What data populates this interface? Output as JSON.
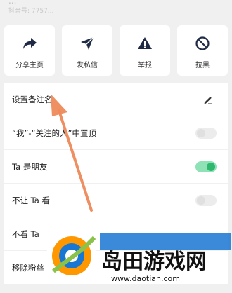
{
  "header": {
    "name_fragment": "...",
    "id_fragment": "抖音号: 7757..."
  },
  "actions": [
    {
      "label": "分享主页",
      "icon": "share-icon"
    },
    {
      "label": "发私信",
      "icon": "send-icon"
    },
    {
      "label": "举报",
      "icon": "warning-icon"
    },
    {
      "label": "拉黑",
      "icon": "block-icon"
    }
  ],
  "settings": [
    {
      "label": "设置备注名",
      "control": "pen-icon"
    },
    {
      "label": "“我”-“关注的人”中置顶",
      "control": "toggle",
      "on": false
    },
    {
      "label": "Ta 是朋友",
      "control": "toggle",
      "on": true
    },
    {
      "label": "不让 Ta 看",
      "control": "toggle",
      "on": false
    },
    {
      "label": "不看 Ta",
      "control": "none"
    },
    {
      "label": "移除粉丝",
      "control": "none"
    }
  ],
  "watermark": {
    "text": "岛田游戏网",
    "url": "www.daotian.com"
  },
  "colors": {
    "background": "#f0f0f0",
    "card": "#ffffff",
    "toggle_on": "#2db76f",
    "arrow": "#ee8a5a",
    "watermark_blue": "#1976d2"
  }
}
